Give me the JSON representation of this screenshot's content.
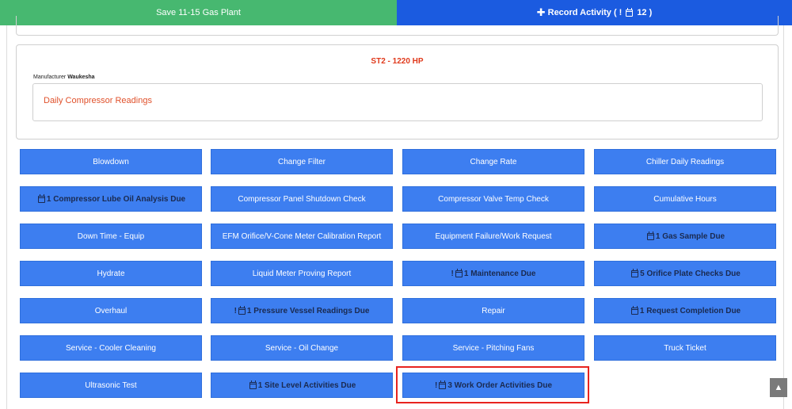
{
  "header": {
    "save_label": "Save 11-15 Gas Plant",
    "record_label": "Record Activity (",
    "record_count": "12 )"
  },
  "unit": {
    "title": "ST2 - 1220 HP",
    "manufacturer_label": "Manufacturer",
    "manufacturer_value": "Waukesha",
    "reading_label": "Daily Compressor Readings"
  },
  "buttons": [
    {
      "label": "Blowdown"
    },
    {
      "label": "Change Filter"
    },
    {
      "label": "Change Rate"
    },
    {
      "label": "Chiller Daily Readings"
    },
    {
      "label": "1 Compressor Lube Oil Analysis Due"
    },
    {
      "label": "Compressor Panel Shutdown Check"
    },
    {
      "label": "Compressor Valve Temp Check"
    },
    {
      "label": "Cumulative Hours"
    },
    {
      "label": "Down Time - Equip"
    },
    {
      "label": "EFM Orifice/V-Cone Meter Calibration Report"
    },
    {
      "label": "Equipment Failure/Work Request"
    },
    {
      "label": "1 Gas Sample Due"
    },
    {
      "label": "Hydrate"
    },
    {
      "label": "Liquid Meter Proving Report"
    },
    {
      "label": "1 Maintenance Due"
    },
    {
      "label": "5 Orifice Plate Checks Due"
    },
    {
      "label": "Overhaul"
    },
    {
      "label": "1 Pressure Vessel Readings Due"
    },
    {
      "label": "Repair"
    },
    {
      "label": "1 Request Completion Due"
    },
    {
      "label": "Service - Cooler Cleaning"
    },
    {
      "label": "Service - Oil Change"
    },
    {
      "label": "Service - Pitching Fans"
    },
    {
      "label": "Truck Ticket"
    },
    {
      "label": "Ultrasonic Test"
    },
    {
      "label": "1 Site Level Activities Due"
    },
    {
      "label": "3 Work Order Activities Due"
    }
  ],
  "colors": {
    "save_green": "#47b870",
    "record_blue": "#1b5be0",
    "button_blue": "#3d7ef0",
    "title_red": "#e0391b",
    "highlight_red": "#e8231e"
  },
  "icons": {
    "calendar": "calendar-icon",
    "exclamation": "exclamation-icon",
    "plus": "plus-icon",
    "scroll_top": "arrow-up-icon"
  }
}
